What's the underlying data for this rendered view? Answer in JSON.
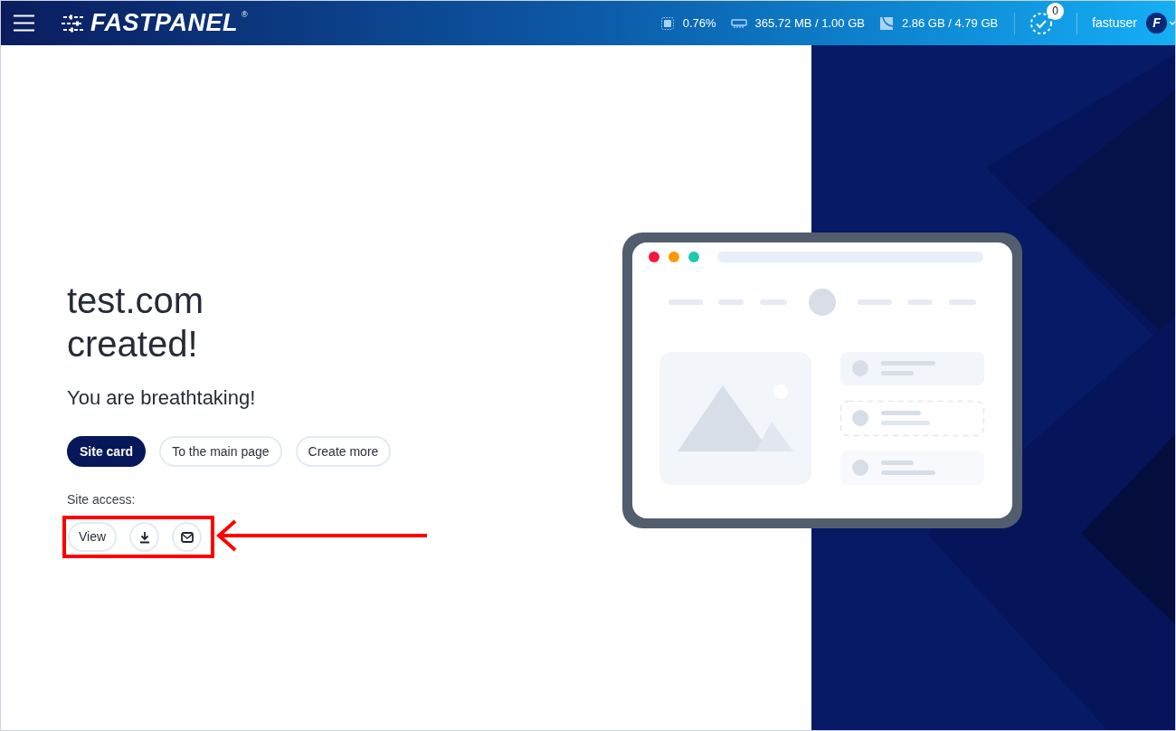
{
  "header": {
    "logo": {
      "text": "FASTPANEL",
      "mark": "®"
    },
    "stats": [
      {
        "kind": "cpu",
        "value": "0.76%"
      },
      {
        "kind": "ram",
        "value": "365.72 MB / 1.00 GB"
      },
      {
        "kind": "disk",
        "value": "2.86 GB / 4.79 GB"
      }
    ],
    "tasks_badge": "0",
    "user": {
      "name": "fastuser",
      "avatar_letter": "F"
    }
  },
  "main": {
    "title_lines": [
      "test.com",
      "created!"
    ],
    "subtitle": "You are breathtaking!",
    "buttons": [
      {
        "label": "Site card",
        "kind": "primary"
      },
      {
        "label": "To the main page",
        "kind": "outline"
      },
      {
        "label": "Create more",
        "kind": "outline"
      }
    ],
    "access_label": "Site access:",
    "access_buttons": [
      {
        "kind": "text",
        "label": "View"
      },
      {
        "kind": "download"
      },
      {
        "kind": "mail"
      }
    ]
  }
}
